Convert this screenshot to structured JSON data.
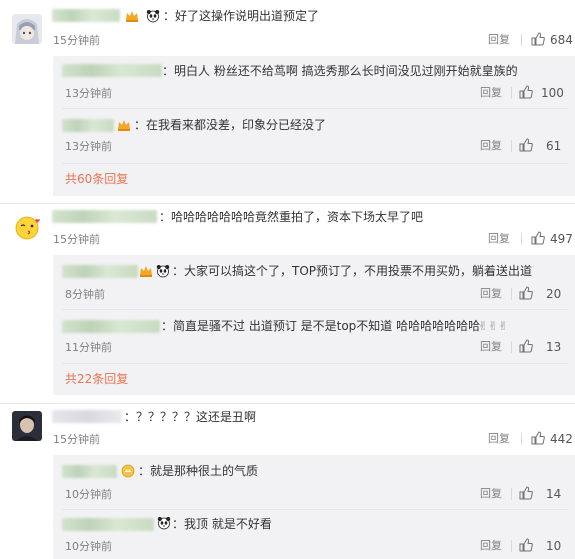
{
  "icons": {
    "like": "thumbs-up-icon",
    "panda": "panda-emoji-icon",
    "crown": "crown-badge-icon"
  },
  "colors": {
    "link": "#eb7350",
    "muted": "#808080",
    "subbg": "#f2f2f5"
  },
  "comments": [
    {
      "text": "：好了这操作说明出道预定了",
      "time": "15分钟前",
      "reply": "回复",
      "likes": "684",
      "subs": [
        {
          "text": "：明白人 粉丝还不给茑啊 搞选秀那么长时间没见过刚开始就皇族的",
          "time": "13分钟前",
          "reply": "回复",
          "likes": "100"
        },
        {
          "text": "：在我看来都没差，印象分已经没了",
          "time": "13分钟前",
          "reply": "回复",
          "likes": "61"
        }
      ],
      "more": "共60条回复"
    },
    {
      "text": "：哈哈哈哈哈哈哈竟然重拍了，资本下场太早了吧",
      "time": "15分钟前",
      "reply": "回复",
      "likes": "497",
      "subs": [
        {
          "text": "：大家可以搞这个了，TOP预订了，不用投票不用买奶，躺着送出道",
          "time": "8分钟前",
          "reply": "回复",
          "likes": "20"
        },
        {
          "text": "：简直是骚不过 出道预订 是不是top不知道 哈哈哈哈哈哈哈",
          "time": "11分钟前",
          "reply": "回复",
          "likes": "13"
        }
      ],
      "more": "共22条回复"
    },
    {
      "text": "：？？？？？这还是丑啊",
      "time": "15分钟前",
      "reply": "回复",
      "likes": "442",
      "subs": [
        {
          "text": "：就是那种很土的气质",
          "time": "10分钟前",
          "reply": "回复",
          "likes": "14"
        },
        {
          "text": "：我顶 就是不好看",
          "time": "10分钟前",
          "reply": "回复",
          "likes": "10"
        }
      ]
    }
  ]
}
